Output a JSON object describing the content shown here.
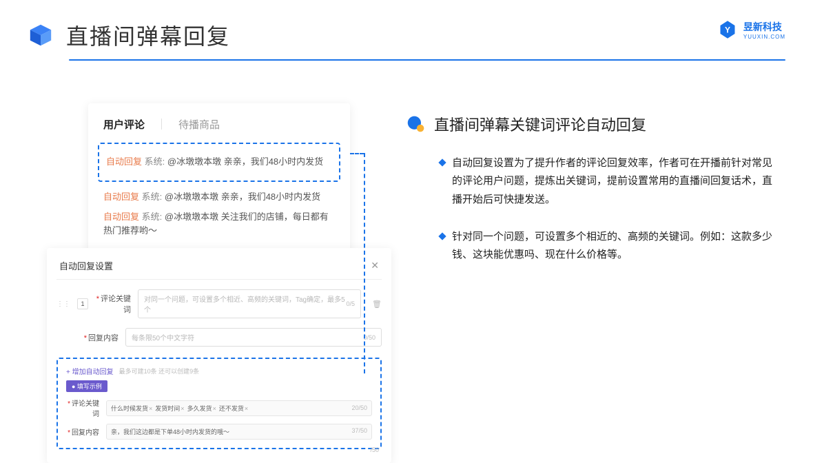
{
  "header": {
    "title": "直播间弹幕回复",
    "brand_cn": "昱新科技",
    "brand_en": "YUUXIN.COM"
  },
  "comments": {
    "tab_active": "用户评论",
    "tab_other": "待播商品",
    "reply_label": "自动回复",
    "sys_label": "系统:",
    "line1": "@冰墩墩本墩 亲亲，我们48小时内发货",
    "line2": "@冰墩墩本墩 亲亲，我们48小时内发货",
    "line3": "@冰墩墩本墩 关注我们的店铺，每日都有热门推荐哟～"
  },
  "settings": {
    "title": "自动回复设置",
    "row_num": "1",
    "keyword_label": "评论关键词",
    "keyword_placeholder": "对同一个问题，可设置多个相近、高频的关键词，Tag确定，最多5个",
    "keyword_counter": "0/5",
    "content_label": "回复内容",
    "content_placeholder": "每条限50个中文字符",
    "content_counter": "0/50",
    "add_label": "+ 增加自动回复",
    "add_hint": "最多可建10条 还可以创建9条",
    "example_badge": "● 填写示例",
    "ex_keyword_label": "评论关键词",
    "ex_tags": [
      "什么时候发货",
      "发货时间",
      "多久发货",
      "还不发货"
    ],
    "ex_keyword_counter": "20/50",
    "ex_content_label": "回复内容",
    "ex_content_value": "亲，我们这边都是下单48小时内发货的哦～",
    "ex_content_counter": "37/50",
    "bottom_counter": "/50"
  },
  "right": {
    "title": "直播间弹幕关键词评论自动回复",
    "bullet1": "自动回复设置为了提升作者的评论回复效率，作者可在开播前针对常见的评论用户问题，提炼出关键词，提前设置常用的直播间回复话术，直播开始后可快捷发送。",
    "bullet2": "针对同一个问题，可设置多个相近的、高频的关键词。例如：这款多少钱、这块能优惠吗、现在什么价格等。"
  }
}
